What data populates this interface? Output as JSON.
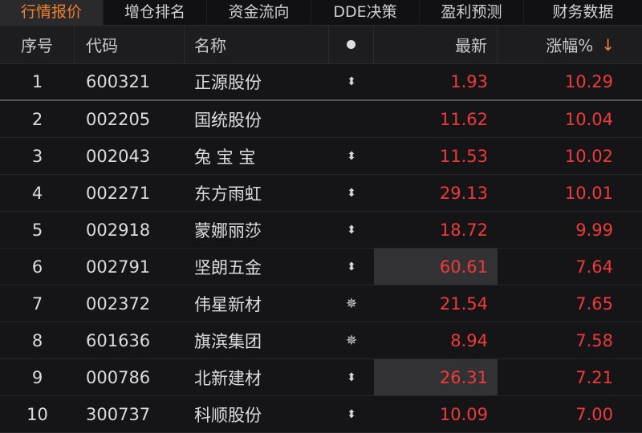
{
  "tabs": [
    {
      "label": "行情报价",
      "active": true
    },
    {
      "label": "增仓排名",
      "active": false
    },
    {
      "label": "资金流向",
      "active": false
    },
    {
      "label": "DDE决策",
      "active": false
    },
    {
      "label": "盈利预测",
      "active": false
    },
    {
      "label": "财务数据",
      "active": false
    }
  ],
  "columns": {
    "no": "序号",
    "code": "代码",
    "name": "名称",
    "mark": "dot-icon",
    "price": "最新",
    "pct": "涨幅%",
    "sort_icon": "arrow-down-icon"
  },
  "colors": {
    "accent": "#f0802f",
    "up": "#ee3a3a",
    "background": "#151517"
  },
  "rows": [
    {
      "no": "1",
      "code": "600321",
      "name": "正源股份",
      "mark": "⬍",
      "mark_icon": "updown-arrow-icon",
      "price": "1.93",
      "pct": "10.29",
      "highlight": false
    },
    {
      "no": "2",
      "code": "002205",
      "name": "国统股份",
      "mark": "",
      "mark_icon": "",
      "price": "11.62",
      "pct": "10.04",
      "highlight": false
    },
    {
      "no": "3",
      "code": "002043",
      "name": "兔 宝 宝",
      "mark": "⬍",
      "mark_icon": "updown-arrow-icon",
      "price": "11.53",
      "pct": "10.02",
      "highlight": false
    },
    {
      "no": "4",
      "code": "002271",
      "name": "东方雨虹",
      "mark": "⬍",
      "mark_icon": "updown-arrow-icon",
      "price": "29.13",
      "pct": "10.01",
      "highlight": false
    },
    {
      "no": "5",
      "code": "002918",
      "name": "蒙娜丽莎",
      "mark": "⬍",
      "mark_icon": "updown-arrow-icon",
      "price": "18.72",
      "pct": "9.99",
      "highlight": false
    },
    {
      "no": "6",
      "code": "002791",
      "name": "坚朗五金",
      "mark": "⬍",
      "mark_icon": "updown-arrow-icon",
      "price": "60.61",
      "pct": "7.64",
      "highlight": true
    },
    {
      "no": "7",
      "code": "002372",
      "name": "伟星新材",
      "mark": "✵",
      "mark_icon": "star-burst-icon",
      "price": "21.54",
      "pct": "7.65",
      "highlight": false
    },
    {
      "no": "8",
      "code": "601636",
      "name": "旗滨集团",
      "mark": "✵",
      "mark_icon": "star-burst-icon",
      "price": "8.94",
      "pct": "7.58",
      "highlight": false
    },
    {
      "no": "9",
      "code": "000786",
      "name": "北新建材",
      "mark": "⬍",
      "mark_icon": "updown-arrow-icon",
      "price": "26.31",
      "pct": "7.21",
      "highlight": true
    },
    {
      "no": "10",
      "code": "300737",
      "name": "科顺股份",
      "mark": "⬍",
      "mark_icon": "updown-arrow-icon",
      "price": "10.09",
      "pct": "7.00",
      "highlight": false
    }
  ]
}
